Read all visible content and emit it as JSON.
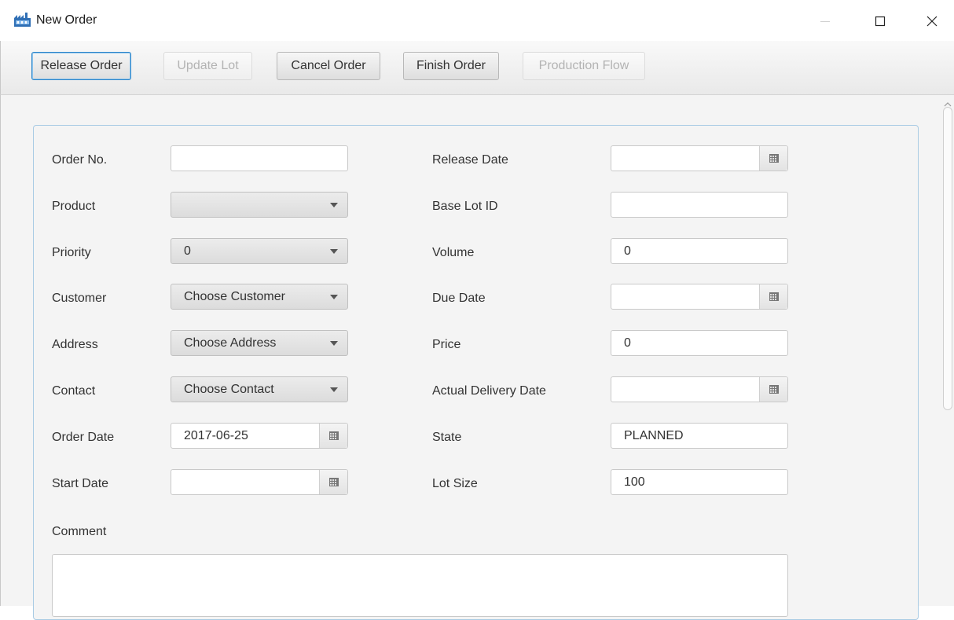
{
  "window": {
    "title": "New Order",
    "icon": "factory-app-icon",
    "controls": [
      "minimize-icon",
      "maximize-icon",
      "close-icon"
    ]
  },
  "toolbar": {
    "release_order": "Release Order",
    "update_lot": "Update Lot",
    "cancel_order": "Cancel Order",
    "finish_order": "Finish Order",
    "production_flow": "Production Flow"
  },
  "form": {
    "left": {
      "order_no": {
        "label": "Order No.",
        "value": ""
      },
      "product": {
        "label": "Product",
        "value": ""
      },
      "priority": {
        "label": "Priority",
        "value": "0"
      },
      "customer": {
        "label": "Customer",
        "value": "Choose Customer"
      },
      "address": {
        "label": "Address",
        "value": "Choose Address"
      },
      "contact": {
        "label": "Contact",
        "value": "Choose Contact"
      },
      "order_date": {
        "label": "Order Date",
        "value": "2017-06-25"
      },
      "start_date": {
        "label": "Start Date",
        "value": ""
      }
    },
    "right": {
      "release_date": {
        "label": "Release Date",
        "value": ""
      },
      "base_lot_id": {
        "label": "Base Lot ID",
        "value": ""
      },
      "volume": {
        "label": "Volume",
        "value": "0"
      },
      "due_date": {
        "label": "Due Date",
        "value": ""
      },
      "price": {
        "label": "Price",
        "value": "0"
      },
      "actual_delivery_date": {
        "label": "Actual Delivery Date",
        "value": ""
      },
      "state": {
        "label": "State",
        "value": "PLANNED"
      },
      "lot_size": {
        "label": "Lot Size",
        "value": "100"
      }
    },
    "comment": {
      "label": "Comment",
      "value": ""
    }
  },
  "colors": {
    "focus_border": "#2a84c9",
    "panel_border": "#a9cbe4",
    "disabled_text": "#b3b3b3"
  }
}
